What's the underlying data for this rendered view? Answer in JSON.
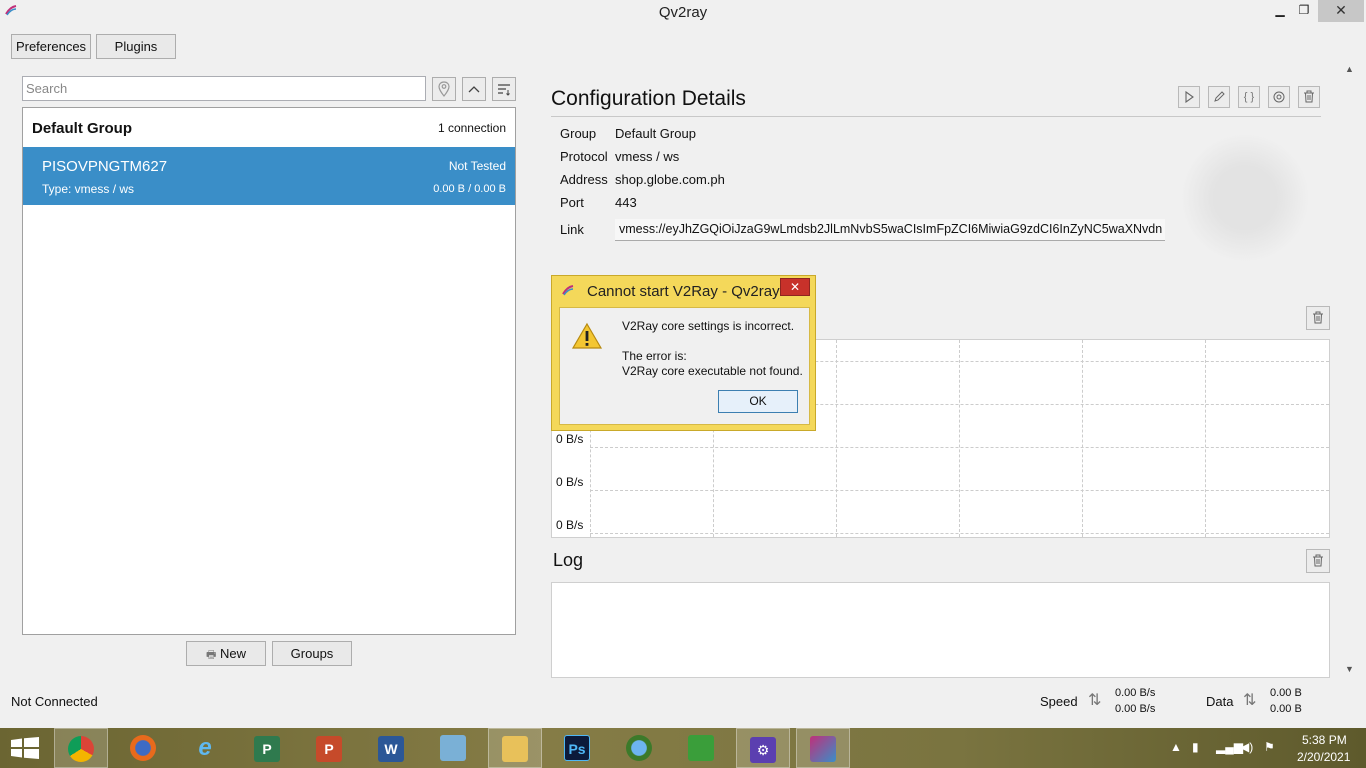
{
  "window": {
    "title": "Qv2ray"
  },
  "toolbar": {
    "preferences": "Preferences",
    "plugins": "Plugins"
  },
  "search": {
    "placeholder": "Search"
  },
  "group": {
    "name": "Default Group",
    "count": "1 connection",
    "connection": {
      "name": "PISOVPNGTM627",
      "status": "Not Tested",
      "type": "Type: vmess / ws",
      "stats": "0.00 B / 0.00 B"
    }
  },
  "bottom_buttons": {
    "new": "New",
    "groups": "Groups"
  },
  "details": {
    "title": "Configuration Details",
    "group_label": "Group",
    "group_value": "Default Group",
    "protocol_label": "Protocol",
    "protocol_value": "vmess / ws",
    "address_label": "Address",
    "address_value": "shop.globe.com.ph",
    "port_label": "Port",
    "port_value": "443",
    "link_label": "Link",
    "link_value": "vmess://eyJhZGQiOiJzaG9wLmdsb2JlLmNvbS5waCIsImFpZCI6MiwiaG9zdCI6InZyNC5waXNvdn"
  },
  "chart": {
    "y_labels": [
      "0 B/s",
      "0 B/s",
      "0 B/s"
    ]
  },
  "log": {
    "title": "Log"
  },
  "statusbar": {
    "connection": "Not Connected",
    "speed_label": "Speed",
    "speed_up": "0.00 B/s",
    "speed_down": "0.00 B/s",
    "data_label": "Data",
    "data_up": "0.00 B",
    "data_down": "0.00 B"
  },
  "dialog": {
    "title": "Cannot start V2Ray - Qv2ray",
    "line1": "V2Ray core settings is incorrect.",
    "line2": "The error is:",
    "line3": "V2Ray core executable not found.",
    "ok": "OK"
  },
  "taskbar": {
    "apps": [
      "chrome-icon",
      "firefox-icon",
      "ie-icon",
      "project-icon",
      "powerpoint-icon",
      "word-icon",
      "notepad-icon",
      "explorer-icon",
      "photoshop-icon",
      "network-icon",
      "store-icon",
      "settings-icon",
      "qv2ray-icon"
    ],
    "ps_label": "Ps",
    "clock_time": "5:38 PM",
    "clock_date": "2/20/2021"
  },
  "colors": {
    "accent": "#3a8ec8",
    "dialog_frame": "#f4d85a"
  }
}
